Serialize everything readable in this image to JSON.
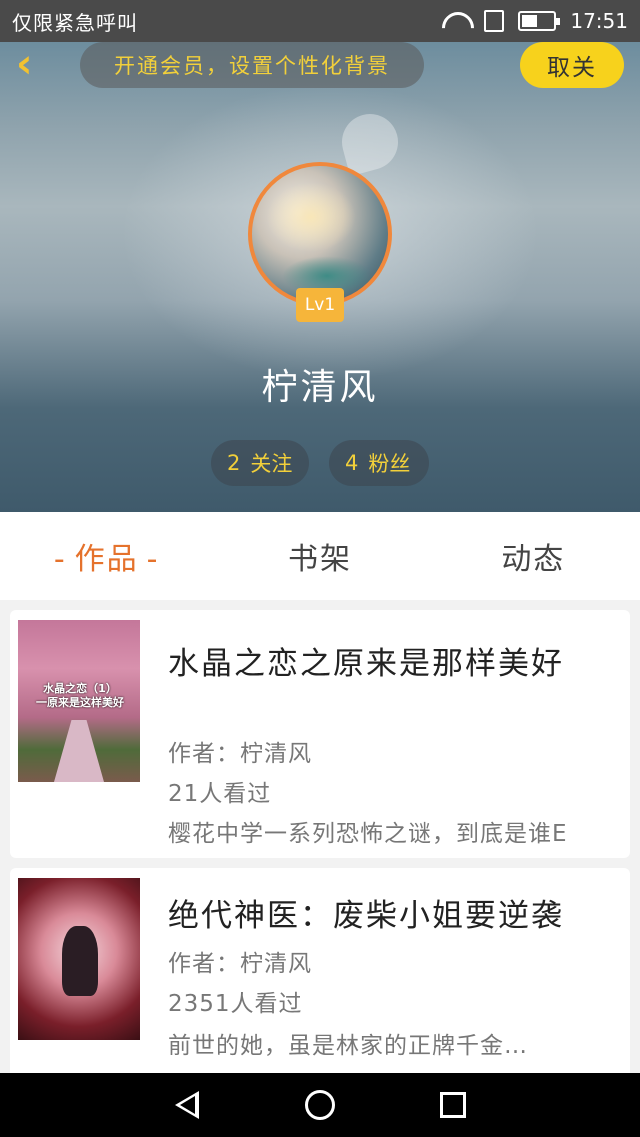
{
  "status_bar": {
    "carrier": "仅限紧急呼叫",
    "time": "17:51",
    "battery_level": 0.5
  },
  "header": {
    "vip_banner": "开通会员，设置个性化背景",
    "close_label": "取关",
    "level_badge": "Lv1",
    "username": "柠清风",
    "follow_count": "2",
    "follow_label": "关注",
    "fans_count": "4",
    "fans_label": "粉丝"
  },
  "tabs": [
    {
      "label": "作品",
      "active": true
    },
    {
      "label": "书架",
      "active": false
    },
    {
      "label": "动态",
      "active": false
    }
  ],
  "books": [
    {
      "cover_text": "水晶之恋（1）\n一原来是这样美好",
      "title": "水晶之恋之原来是那样美好",
      "author": "作者：柠清风",
      "views": "21人看过",
      "summary": "樱花中学一系列恐怖之谜，到底是谁E"
    },
    {
      "cover_text": "",
      "title": "绝代神医：废柴小姐要逆袭",
      "author": "作者：柠清风",
      "views": "2351人看过",
      "summary": "前世的她，虽是林家的正牌千金…"
    }
  ],
  "colors": {
    "accent": "#e5722c",
    "highlight": "#f2d03a",
    "close_button": "#f7d21c"
  }
}
